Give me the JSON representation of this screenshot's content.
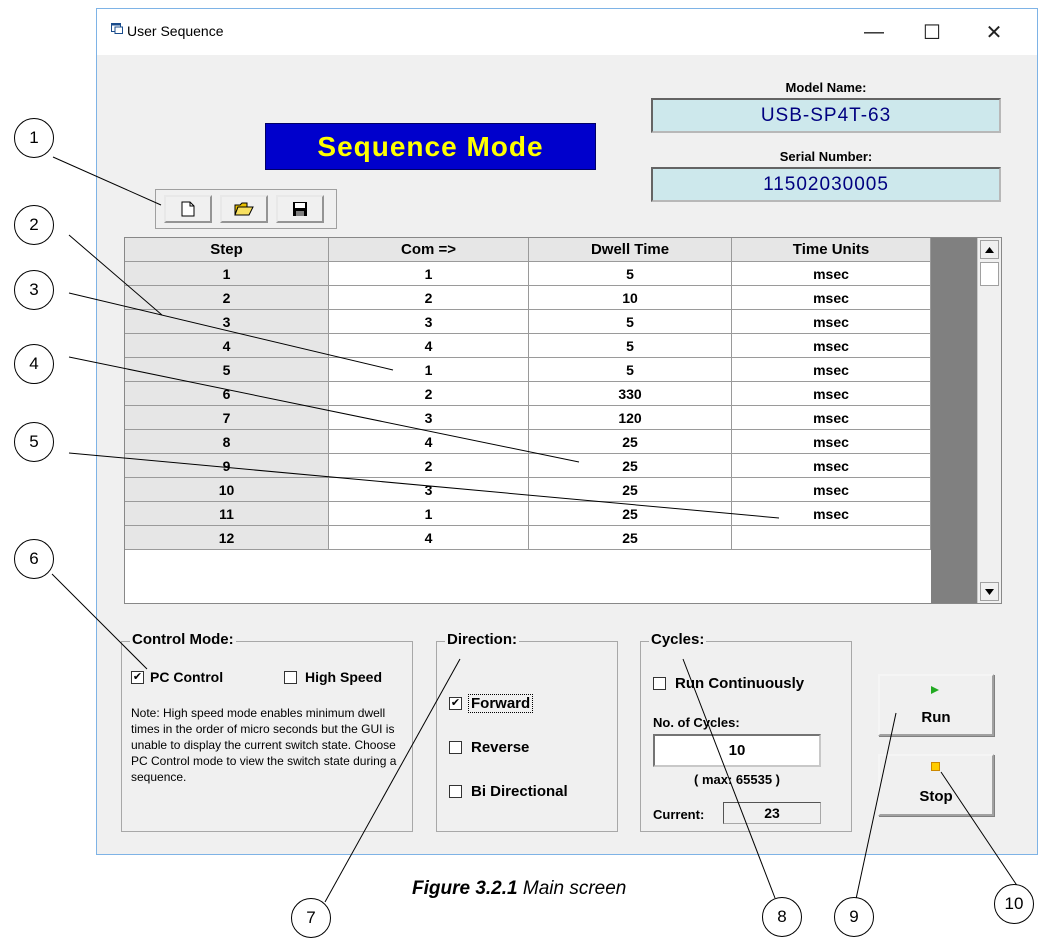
{
  "window": {
    "title": "User Sequence",
    "minimize_glyph": "—",
    "maximize_glyph": "☐",
    "close_glyph": "✕"
  },
  "banner": "Sequence Mode",
  "model": {
    "label": "Model Name:",
    "value": "USB-SP4T-63"
  },
  "serial": {
    "label": "Serial Number:",
    "value": "11502030005"
  },
  "toolbar": {
    "icons": [
      "new-file-icon",
      "open-folder-icon",
      "save-disk-icon"
    ]
  },
  "grid": {
    "headers": [
      "Step",
      "Com =>",
      "Dwell Time",
      "Time Units"
    ],
    "rows": [
      [
        "1",
        "1",
        "5",
        "msec"
      ],
      [
        "2",
        "2",
        "10",
        "msec"
      ],
      [
        "3",
        "3",
        "5",
        "msec"
      ],
      [
        "4",
        "4",
        "5",
        "msec"
      ],
      [
        "5",
        "1",
        "5",
        "msec"
      ],
      [
        "6",
        "2",
        "330",
        "msec"
      ],
      [
        "7",
        "3",
        "120",
        "msec"
      ],
      [
        "8",
        "4",
        "25",
        "msec"
      ],
      [
        "9",
        "2",
        "25",
        "msec"
      ],
      [
        "10",
        "3",
        "25",
        "msec"
      ],
      [
        "11",
        "1",
        "25",
        "msec"
      ],
      [
        "12",
        "4",
        "25",
        ""
      ]
    ]
  },
  "control_mode": {
    "title": "Control Mode:",
    "pc_control": {
      "label": "PC Control",
      "checked": true
    },
    "high_speed": {
      "label": "High Speed",
      "checked": false
    },
    "note": "Note: High speed mode enables minimum dwell times in the order of micro seconds but the GUI is unable to display the current switch state. Choose PC Control mode to view the switch state during a sequence."
  },
  "direction": {
    "title": "Direction:",
    "forward": {
      "label": "Forward",
      "checked": true
    },
    "reverse": {
      "label": "Reverse",
      "checked": false
    },
    "bidirectional": {
      "label": "Bi Directional",
      "checked": false
    }
  },
  "cycles": {
    "title": "Cycles:",
    "run_continuously": {
      "label": "Run Continuously",
      "checked": false
    },
    "no_cycles_label": "No. of Cycles:",
    "no_cycles_value": "10",
    "max_text": "( max: 65535 )",
    "current_label": "Current:",
    "current_value": "23"
  },
  "buttons": {
    "run": {
      "label": "Run",
      "icon": "play-icon",
      "icon_color": "#22aa22"
    },
    "stop": {
      "label": "Stop",
      "icon": "stop-icon",
      "icon_color": "#ffcc00"
    }
  },
  "callouts": [
    "1",
    "2",
    "3",
    "4",
    "5",
    "6",
    "7",
    "8",
    "9",
    "10"
  ],
  "caption": {
    "bold": "Figure 3.2.1",
    "rest": " Main screen"
  },
  "colors": {
    "banner_bg": "#0000cc",
    "banner_fg": "#ffff00",
    "field_bg": "#cde8ec",
    "field_fg": "#000080"
  }
}
